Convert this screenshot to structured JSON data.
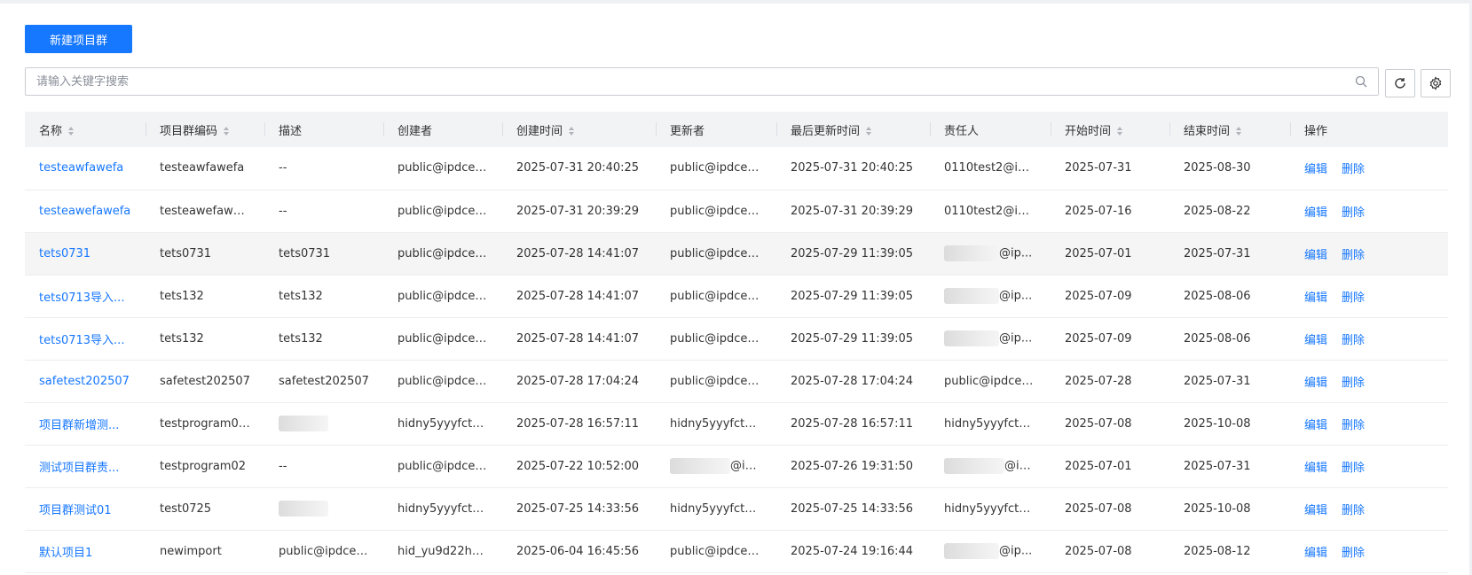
{
  "toolbar": {
    "new_button": "新建项目群"
  },
  "search": {
    "placeholder": "请输入关键字搜索"
  },
  "icons": {
    "search": "search-icon",
    "refresh": "refresh-icon",
    "settings": "gear-icon",
    "sort": "sort-icon"
  },
  "colors": {
    "primary": "#1677ff",
    "header_bg": "#f2f3f5",
    "row_hover": "#f5f5f5"
  },
  "table": {
    "columns": [
      {
        "label": "名称",
        "sortable": true
      },
      {
        "label": "项目群编码",
        "sortable": true
      },
      {
        "label": "描述",
        "sortable": false
      },
      {
        "label": "创建者",
        "sortable": false
      },
      {
        "label": "创建时间",
        "sortable": true
      },
      {
        "label": "更新者",
        "sortable": false
      },
      {
        "label": "最后更新时间",
        "sortable": true
      },
      {
        "label": "责任人",
        "sortable": false
      },
      {
        "label": "开始时间",
        "sortable": true
      },
      {
        "label": "结束时间",
        "sortable": true
      },
      {
        "label": "操作",
        "sortable": false
      }
    ],
    "actions": {
      "edit": "编辑",
      "delete": "删除"
    },
    "rows": [
      {
        "name": "testeawfawefa",
        "code": "testeawfawefa",
        "desc": "--",
        "creator": "public@ipdcen...",
        "created": "2025-07-31 20:40:25",
        "updater": "public@ipdcen...",
        "updated": "2025-07-31 20:40:25",
        "owner": "0110test2@ipd...",
        "start": "2025-07-31",
        "end": "2025-08-30"
      },
      {
        "name": "testeawefawefa",
        "code": "testeawefawefa",
        "desc": "--",
        "creator": "public@ipdcen...",
        "created": "2025-07-31 20:39:29",
        "updater": "public@ipdcen...",
        "updated": "2025-07-31 20:39:29",
        "owner": "0110test2@ipd...",
        "start": "2025-07-16",
        "end": "2025-08-22"
      },
      {
        "name": "tets0731",
        "code": "tets0731",
        "desc": "tets0731",
        "creator": "public@ipdcen...",
        "created": "2025-07-28 14:41:07",
        "updater": "public@ipdcen...",
        "updated": "2025-07-29 11:39:05",
        "owner": "@ip...",
        "start": "2025-07-01",
        "end": "2025-07-31"
      },
      {
        "name": "tets0713导入...",
        "code": "tets132",
        "desc": "tets132",
        "creator": "public@ipdcen...",
        "created": "2025-07-28 14:41:07",
        "updater": "public@ipdcen...",
        "updated": "2025-07-29 11:39:05",
        "owner": "@ip...",
        "start": "2025-07-09",
        "end": "2025-08-06"
      },
      {
        "name": "tets0713导入...",
        "code": "tets132",
        "desc": "tets132",
        "creator": "public@ipdcen...",
        "created": "2025-07-28 14:41:07",
        "updater": "public@ipdcen...",
        "updated": "2025-07-29 11:39:05",
        "owner": "@ip...",
        "start": "2025-07-09",
        "end": "2025-08-06"
      },
      {
        "name": "safetest202507",
        "code": "safetest202507",
        "desc": "safetest202507",
        "creator": "public@ipdcen...",
        "created": "2025-07-28 17:04:24",
        "updater": "public@ipdcen...",
        "updated": "2025-07-28 17:04:24",
        "owner": "public@ipdcen...",
        "start": "2025-07-28",
        "end": "2025-07-31"
      },
      {
        "name": "项目群新增测...",
        "code": "testprogram00...",
        "desc": "",
        "creator": "hidny5yyyfctw8...",
        "created": "2025-07-28 16:57:11",
        "updater": "hidny5yyyfctw...",
        "updated": "2025-07-28 16:57:11",
        "owner": "hidny5yyyfctw...",
        "start": "2025-07-08",
        "end": "2025-10-08"
      },
      {
        "name": "测试项目群责...",
        "code": "testprogram02",
        "desc": "--",
        "creator": "public@ipdcen...",
        "created": "2025-07-22 10:52:00",
        "updater": "@ip...",
        "updated": "2025-07-26 19:31:50",
        "owner": "@ip...",
        "start": "2025-07-01",
        "end": "2025-07-31"
      },
      {
        "name": "项目群测试01",
        "code": "test0725",
        "desc": "",
        "creator": "hidny5yyyfctw8...",
        "created": "2025-07-25 14:33:56",
        "updater": "hidny5yyyfctw...",
        "updated": "2025-07-25 14:33:56",
        "owner": "hidny5yyyfctw...",
        "start": "2025-07-08",
        "end": "2025-10-08"
      },
      {
        "name": "默认项目1",
        "code": "newimport",
        "desc": "public@ipdcen...",
        "creator": "hid_yu9d22ho...",
        "created": "2025-06-04 16:45:56",
        "updater": "public@ipdcen...",
        "updated": "2025-07-24 19:16:44",
        "owner": "@ip...",
        "start": "2025-07-08",
        "end": "2025-08-12"
      }
    ]
  }
}
